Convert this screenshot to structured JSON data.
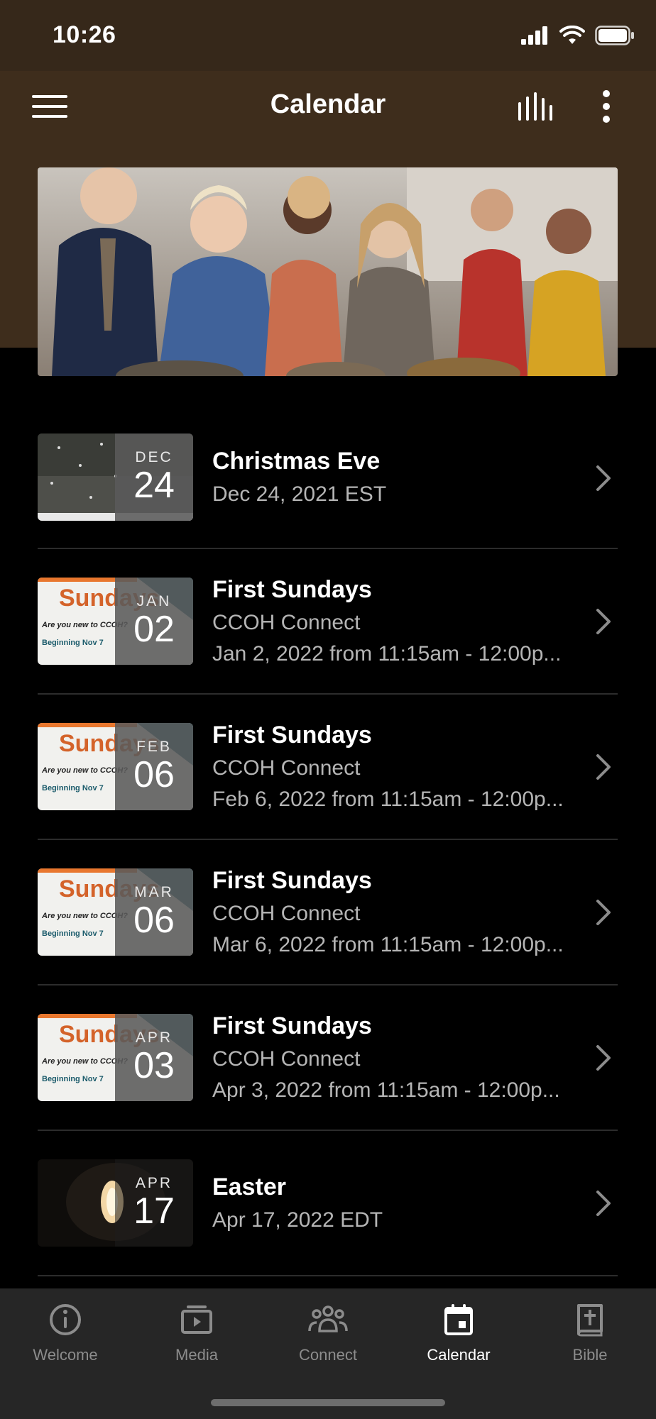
{
  "status": {
    "time": "10:26"
  },
  "nav": {
    "title": "Calendar"
  },
  "events": [
    {
      "month": "DEC",
      "day": "24",
      "title": "Christmas Eve",
      "line1": "Dec 24, 2021 EST",
      "line2": "",
      "thumb": "snow"
    },
    {
      "month": "JAN",
      "day": "02",
      "title": "First Sundays",
      "line1": "CCOH Connect",
      "line2": "Jan 2, 2022 from 11:15am - 12:00p...",
      "thumb": "sundays"
    },
    {
      "month": "FEB",
      "day": "06",
      "title": "First Sundays",
      "line1": "CCOH Connect",
      "line2": "Feb 6, 2022 from 11:15am - 12:00p...",
      "thumb": "sundays"
    },
    {
      "month": "MAR",
      "day": "06",
      "title": "First Sundays",
      "line1": "CCOH Connect",
      "line2": "Mar 6, 2022 from 11:15am - 12:00p...",
      "thumb": "sundays"
    },
    {
      "month": "APR",
      "day": "03",
      "title": "First Sundays",
      "line1": "CCOH Connect",
      "line2": "Apr 3, 2022 from 11:15am - 12:00p...",
      "thumb": "sundays"
    },
    {
      "month": "APR",
      "day": "17",
      "title": "Easter",
      "line1": "Apr 17, 2022 EDT",
      "line2": "",
      "thumb": "tomb"
    }
  ],
  "sundays_thumb": {
    "word": "Sundays",
    "question": "Are you new to CCOH?",
    "beginning": "Beginning Nov 7"
  },
  "tabs": [
    {
      "label": "Welcome",
      "icon": "info-icon"
    },
    {
      "label": "Media",
      "icon": "media-icon"
    },
    {
      "label": "Connect",
      "icon": "people-icon"
    },
    {
      "label": "Calendar",
      "icon": "calendar-icon",
      "active": true
    },
    {
      "label": "Bible",
      "icon": "bible-icon"
    }
  ],
  "colors": {
    "header": "#3e2d1c",
    "tabbar": "#262626",
    "accent": "#ffffff"
  }
}
